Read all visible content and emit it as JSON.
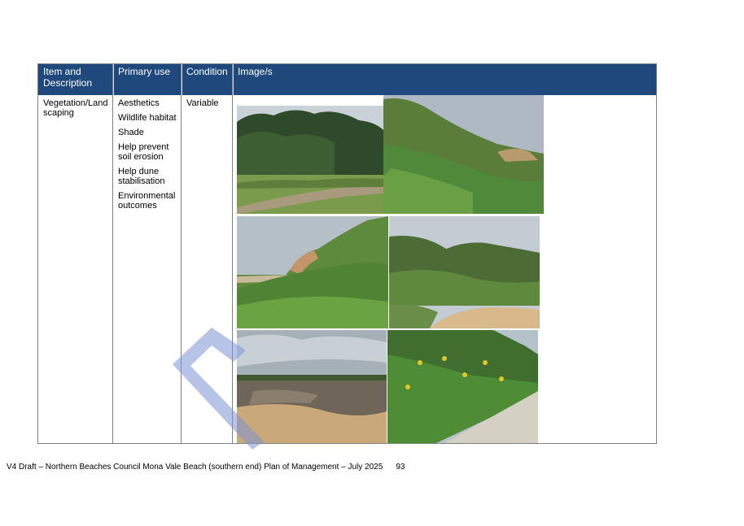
{
  "table": {
    "headers": [
      "Item and Description",
      "Primary use",
      "Condition",
      "Image/s"
    ],
    "row": {
      "item": "Vegetation/Landscaping",
      "item_line1": "Vegetation/Land",
      "item_line2": "scaping",
      "primary_uses": [
        "Aesthetics",
        "Wildlife habitat",
        "Shade",
        "Help prevent soil erosion",
        "Help dune stabilisation",
        "Environmental outcomes"
      ],
      "condition": "Variable"
    },
    "header_color": "#1f497d"
  },
  "photos": [
    {
      "subject": "coastal-shrubs-and-grass-path"
    },
    {
      "subject": "vegetated-dune-slope"
    },
    {
      "subject": "dune-with-sandstone-cliff"
    },
    {
      "subject": "dune-scrub-and-sand"
    },
    {
      "subject": "open-sandy-area-with-debris"
    },
    {
      "subject": "flowering-shrubs-beside-path"
    }
  ],
  "footer": {
    "text": "V4 Draft – Northern Beaches Council Mona Vale Beach (southern end) Plan of Management – July 2025",
    "page_number": "93"
  }
}
